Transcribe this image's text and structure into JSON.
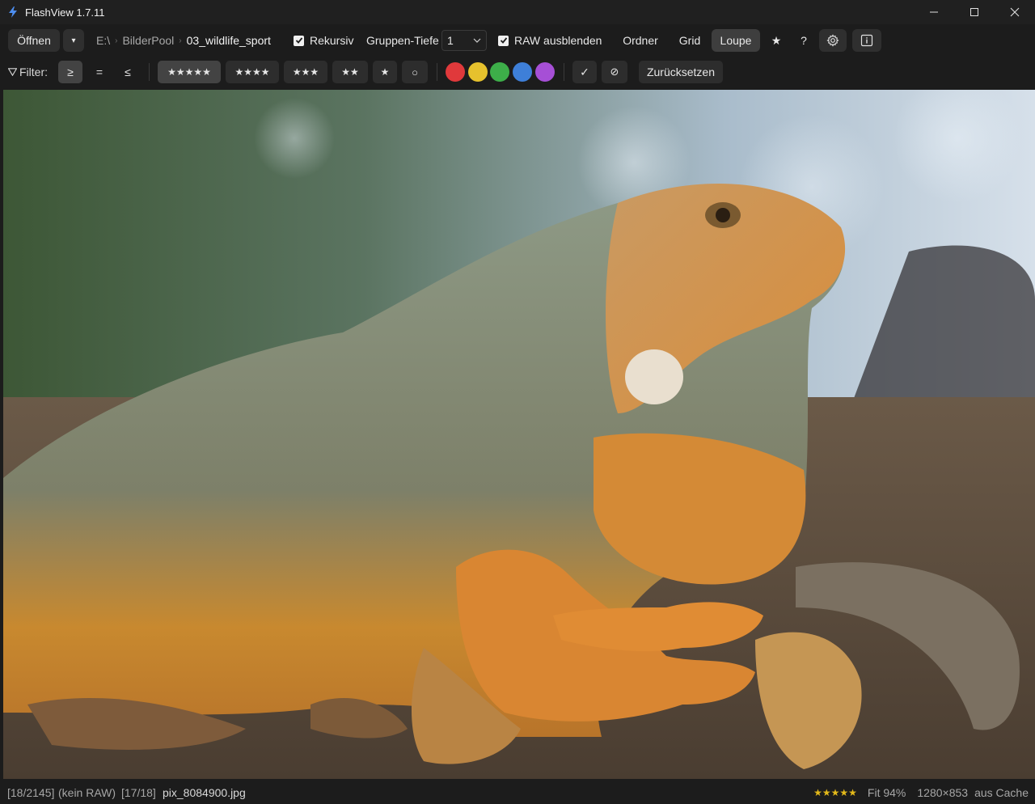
{
  "window": {
    "title": "FlashView 1.7.11"
  },
  "toolbar": {
    "open_label": "Öffnen",
    "open_dropdown": "▾",
    "breadcrumb": [
      "E:\\",
      "BilderPool",
      "03_wildlife_sport"
    ],
    "recursive_label": "Rekursiv",
    "recursive_checked": true,
    "group_depth_label": "Gruppen-Tiefe",
    "group_depth_value": "1",
    "hide_raw_label": "RAW ausblenden",
    "hide_raw_checked": true,
    "view_folder": "Ordner",
    "view_grid": "Grid",
    "view_loupe": "Loupe",
    "active_view": "Loupe",
    "star_button": "★",
    "help_button": "?",
    "settings_icon": "gear-icon",
    "info_icon": "info-icon"
  },
  "filter": {
    "label": "Filter:",
    "ops": [
      "≥",
      "=",
      "≤"
    ],
    "active_op": "≥",
    "ratings": [
      "★★★★★",
      "★★★★",
      "★★★",
      "★★",
      "★",
      "○"
    ],
    "active_rating": "★★★★★",
    "colors": [
      "#e0393b",
      "#e6c12d",
      "#3dae49",
      "#3e7fd8",
      "#a64fd6"
    ],
    "flag_pick": "✓",
    "flag_reject": "⊘",
    "reset_label": "Zurücksetzen"
  },
  "status": {
    "index": "[18/2145]",
    "raw_info": "(kein RAW)",
    "group_index": "[17/18]",
    "filename": "pix_8084900.jpg",
    "rating_stars": "★★★★★",
    "zoom": "Fit 94%",
    "dimensions": "1280×853",
    "cache": "aus Cache"
  },
  "colors": {
    "background": "#1c1c1c",
    "button": "#2f2f2f",
    "active_button": "#3e3e3e",
    "star_gold": "#e3b91a"
  }
}
